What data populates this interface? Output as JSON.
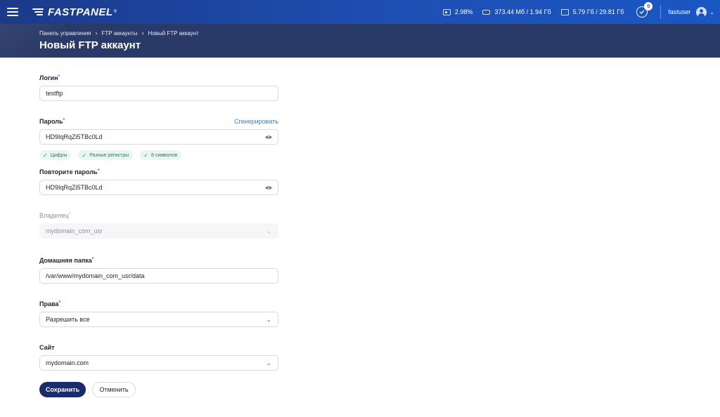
{
  "topbar": {
    "logo": "FASTPANEL",
    "logo_reg": "®",
    "stats": [
      {
        "icon": "cpu-icon",
        "value": "2.98%"
      },
      {
        "icon": "ram-icon",
        "value": "373.44 Мб / 1.94 Гб"
      },
      {
        "icon": "disk-icon",
        "value": "5.79 Гб / 29.81 Гб"
      }
    ],
    "notifications_count": "0",
    "username": "fastuser"
  },
  "breadcrumb": [
    "Панель управления",
    "FTP аккаунты",
    "Новый FTP аккаунт"
  ],
  "page_title": "Новый FTP аккаунт",
  "form": {
    "login": {
      "label": "Логин",
      "value": "testftp"
    },
    "password": {
      "label": "Пароль",
      "value": "HD9IqRqZi5TBc0Ld",
      "generate": "Сгенерировать"
    },
    "requirements": [
      "Цифры",
      "Разные регистры",
      "8 символов"
    ],
    "repeat_password": {
      "label": "Повторите пароль",
      "value": "HD9IqRqZi5TBc0Ld"
    },
    "owner": {
      "label": "Владелец",
      "value": "mydomain_com_usr"
    },
    "home_dir": {
      "label": "Домашняя папка",
      "value": "/var/www/mydomain_com_usr/data"
    },
    "rights": {
      "label": "Права",
      "value": "Разрешить все"
    },
    "site": {
      "label": "Сайт",
      "value": "mydomain.com"
    }
  },
  "buttons": {
    "save": "Сохранить",
    "cancel": "Отменить"
  },
  "colors": {
    "topbar": "#1e4fb3",
    "header": "#2a3a68",
    "primary_button": "#1b2b6b",
    "link": "#2f7fd1",
    "required": "#e23b3b",
    "success": "#21a06a"
  }
}
